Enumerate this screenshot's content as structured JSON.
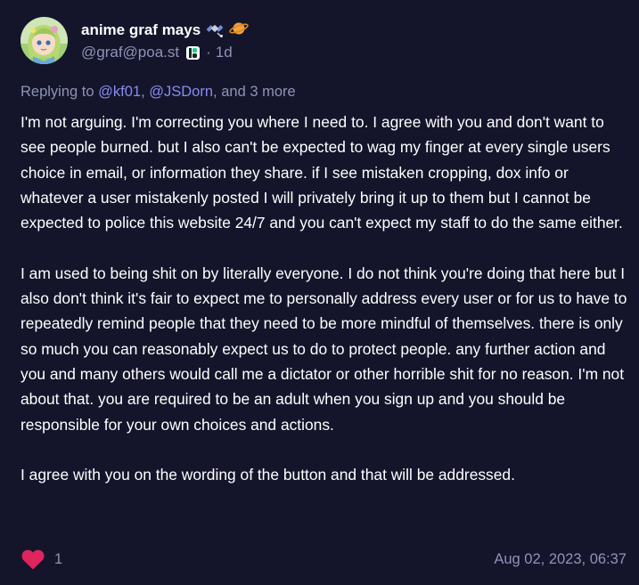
{
  "post": {
    "author": {
      "display_name": "anime graf mays",
      "name_emojis": [
        "satellite-icon",
        "ringed-planet-icon"
      ],
      "handle": "@graf@poa.st",
      "instance_icon": "pleroma-instance-icon",
      "separator": "·",
      "time_ago": "1d"
    },
    "reply": {
      "prefix": "Replying to ",
      "mention_1": "@kf01",
      "comma_1": ",",
      "mention_2": "@JSDorn",
      "suffix": ", and 3 more"
    },
    "paragraphs": [
      "I'm not arguing. I'm correcting you where I need to. I agree with you and don't want to see people burned. but I also can't be expected to wag my finger at every single users choice in email, or information they share. if I see mistaken cropping, dox info or whatever a user mistakenly posted I will privately bring it up to them but I cannot be expected to police this website 24/7 and you can't expect my staff to do the same either.",
      "I am used to being shit on by literally everyone. I do not think you're doing that here but I also don't think it's fair to expect me to personally address every user or for us to have to repeatedly remind people that they need to be more mindful of themselves. there is only so much you can reasonably expect us to do to protect people. any further action and you and many others would call me a dictator or other horrible shit for no reason. I'm not about that. you are required to be an adult when you sign up and you should be responsible for your own choices and actions.",
      "I agree with you on the wording of the button and that will be addressed."
    ],
    "footer": {
      "like_icon": "heart-icon",
      "like_count": "1",
      "timestamp": "Aug 02, 2023, 06:37"
    }
  },
  "colors": {
    "background": "#14152b",
    "text": "#ffffff",
    "muted": "#8f93b5",
    "mention": "#8a8cf0",
    "heart": "#e0245e"
  }
}
